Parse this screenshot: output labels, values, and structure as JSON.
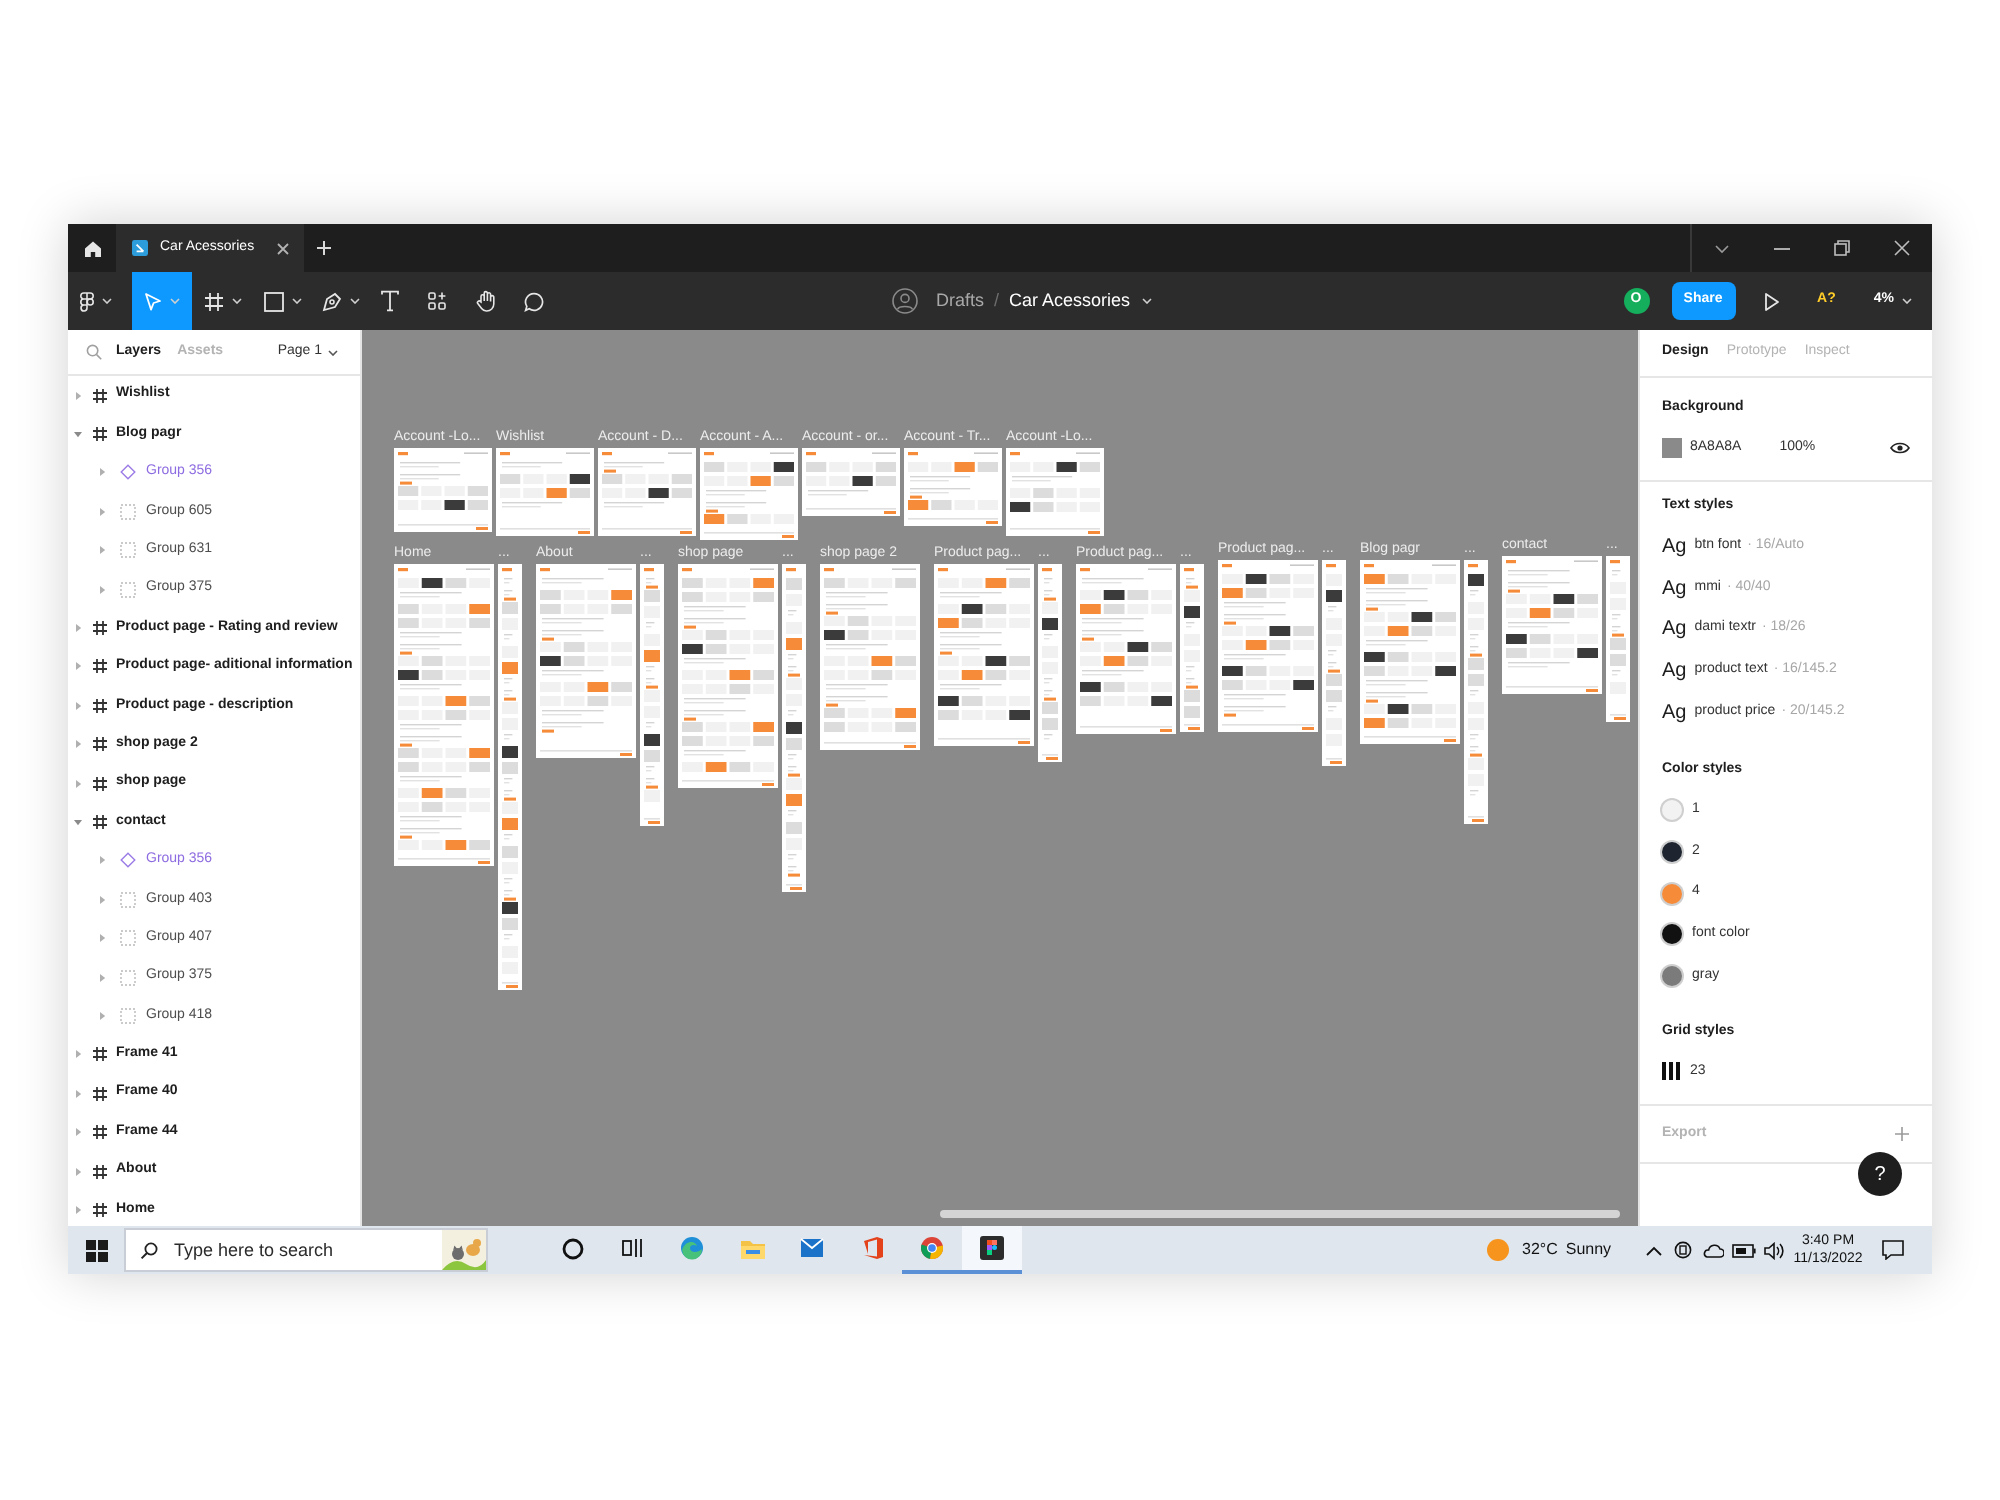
{
  "title_bar": {
    "tabs": [
      {
        "label": "Car Acessories",
        "selected": true
      }
    ]
  },
  "toolbar": {
    "tools": [
      {
        "kind": "main-menu",
        "selected": false,
        "has_menu": true
      },
      {
        "kind": "move",
        "selected": true,
        "has_menu": true
      },
      {
        "kind": "frame",
        "selected": false,
        "has_menu": true
      },
      {
        "kind": "shape",
        "selected": false,
        "has_menu": true
      },
      {
        "kind": "pen",
        "selected": false,
        "has_menu": true
      },
      {
        "kind": "text",
        "selected": false,
        "has_menu": false
      },
      {
        "kind": "resources",
        "selected": false,
        "has_menu": false
      },
      {
        "kind": "hand",
        "selected": false,
        "has_menu": false
      },
      {
        "kind": "comment",
        "selected": false,
        "has_menu": false
      }
    ],
    "breadcrumb": {
      "folder": "Drafts",
      "separator": "/",
      "file": "Car Acessories"
    },
    "user_initial": "O",
    "share_button": "Share",
    "font_warning": "A?",
    "zoom": "4%"
  },
  "layers_panel": {
    "tabs": [
      {
        "label": "Layers",
        "selected": true
      },
      {
        "label": "Assets",
        "selected": false
      }
    ],
    "page": "Page 1",
    "layers": [
      {
        "name": "Wishlist",
        "kind": "frame",
        "expanded": false
      },
      {
        "name": "Blog pagr",
        "kind": "frame",
        "expanded": true,
        "children": [
          {
            "name": "Group 356",
            "kind": "component",
            "expanded": false
          },
          {
            "name": "Group 605",
            "kind": "group",
            "expanded": false
          },
          {
            "name": "Group 631",
            "kind": "group",
            "expanded": false
          },
          {
            "name": "Group 375",
            "kind": "group",
            "expanded": false
          }
        ]
      },
      {
        "name": "Product page - Rating and review",
        "kind": "frame",
        "expanded": false
      },
      {
        "name": "Product page- aditional information",
        "kind": "frame",
        "expanded": false
      },
      {
        "name": "Product page - description",
        "kind": "frame",
        "expanded": false
      },
      {
        "name": "shop page 2",
        "kind": "frame",
        "expanded": false
      },
      {
        "name": "shop page",
        "kind": "frame",
        "expanded": false
      },
      {
        "name": "contact",
        "kind": "frame",
        "expanded": true,
        "children": [
          {
            "name": "Group 356",
            "kind": "component",
            "expanded": false
          },
          {
            "name": "Group 403",
            "kind": "group",
            "expanded": false
          },
          {
            "name": "Group 407",
            "kind": "group",
            "expanded": false
          },
          {
            "name": "Group 375",
            "kind": "group",
            "expanded": false
          },
          {
            "name": "Group 418",
            "kind": "group",
            "expanded": false
          }
        ]
      },
      {
        "name": "Frame 41",
        "kind": "frame",
        "expanded": false
      },
      {
        "name": "Frame 40",
        "kind": "frame",
        "expanded": false
      },
      {
        "name": "Frame 44",
        "kind": "frame",
        "expanded": false
      },
      {
        "name": "About",
        "kind": "frame",
        "expanded": false
      },
      {
        "name": "Home",
        "kind": "frame",
        "expanded": false
      }
    ]
  },
  "canvas": {
    "rows": [
      {
        "frames": [
          {
            "label": "Account -Lo...",
            "kind": "desktop"
          },
          {
            "label": "Wishlist",
            "kind": "desktop"
          },
          {
            "label": "Account - D...",
            "kind": "desktop"
          },
          {
            "label": "Account - A...",
            "kind": "desktop"
          },
          {
            "label": "Account - or...",
            "kind": "desktop"
          },
          {
            "label": "Account - Tr...",
            "kind": "desktop"
          },
          {
            "label": "Account -Lo...",
            "kind": "desktop"
          }
        ]
      },
      {
        "frames": [
          {
            "label": "Home",
            "kind": "desktop"
          },
          {
            "label": "...",
            "kind": "mobile"
          },
          {
            "label": "About",
            "kind": "desktop"
          },
          {
            "label": "...",
            "kind": "mobile"
          },
          {
            "label": "shop page",
            "kind": "desktop"
          },
          {
            "label": "...",
            "kind": "mobile"
          },
          {
            "label": "shop page 2",
            "kind": "desktop"
          },
          {
            "label": "Product pag...",
            "kind": "desktop"
          },
          {
            "label": "...",
            "kind": "mobile"
          },
          {
            "label": "Product pag...",
            "kind": "desktop"
          },
          {
            "label": "...",
            "kind": "mobile"
          },
          {
            "label": "Product pag...",
            "kind": "desktop"
          },
          {
            "label": "...",
            "kind": "mobile"
          },
          {
            "label": "Blog pagr",
            "kind": "desktop"
          },
          {
            "label": "...",
            "kind": "mobile"
          },
          {
            "label": "contact",
            "kind": "desktop"
          },
          {
            "label": "...",
            "kind": "mobile"
          }
        ]
      }
    ]
  },
  "design_panel": {
    "tabs": [
      {
        "label": "Design",
        "selected": true
      },
      {
        "label": "Prototype",
        "selected": false
      },
      {
        "label": "Inspect",
        "selected": false
      }
    ],
    "background": {
      "title": "Background",
      "hex": "8A8A8A",
      "opacity": "100%"
    },
    "text_styles": {
      "title": "Text styles",
      "items": [
        {
          "sample": "Ag",
          "name": "btn font",
          "detail": "· 16/Auto"
        },
        {
          "sample": "Ag",
          "name": "mmi",
          "detail": "· 40/40"
        },
        {
          "sample": "Ag",
          "name": "dami textr",
          "detail": "· 18/26"
        },
        {
          "sample": "Ag",
          "name": "product text",
          "detail": "· 16/145.2"
        },
        {
          "sample": "Ag",
          "name": "product price",
          "detail": "· 20/145.2"
        }
      ]
    },
    "color_styles": {
      "title": "Color styles",
      "items": [
        {
          "name": "1",
          "color": "#f2f2f2"
        },
        {
          "name": "2",
          "color": "#1e2530"
        },
        {
          "name": "4",
          "color": "#f68b39"
        },
        {
          "name": "font color",
          "color": "#111111"
        },
        {
          "name": "gray",
          "color": "#7b7b7b"
        }
      ]
    },
    "grid_styles": {
      "title": "Grid styles",
      "items": [
        {
          "name": "23"
        }
      ]
    },
    "export": {
      "title": "Export"
    },
    "help_button": "?"
  },
  "taskbar": {
    "search_placeholder": "Type here to search",
    "apps": [
      {
        "kind": "cortana",
        "running": false,
        "selected": false
      },
      {
        "kind": "task-view",
        "running": false,
        "selected": false
      },
      {
        "kind": "edge",
        "running": false,
        "selected": false
      },
      {
        "kind": "files",
        "running": false,
        "selected": false
      },
      {
        "kind": "mail",
        "running": false,
        "selected": false
      },
      {
        "kind": "office",
        "running": false,
        "selected": false
      },
      {
        "kind": "chrome",
        "running": true,
        "selected": false
      },
      {
        "kind": "figma",
        "running": true,
        "selected": true
      }
    ],
    "weather": {
      "temperature": "32°C",
      "condition": "Sunny"
    },
    "clock": {
      "time": "3:40 PM",
      "date": "11/13/2022"
    }
  }
}
